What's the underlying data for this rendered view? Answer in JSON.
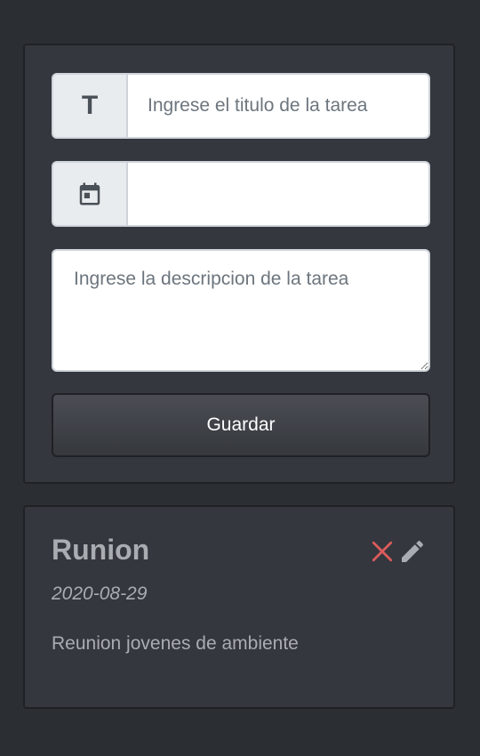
{
  "form": {
    "title_icon": "T",
    "title_placeholder": "Ingrese el titulo de la tarea",
    "title_value": "",
    "date_icon": "calendar-icon",
    "date_value": "",
    "description_placeholder": "Ingrese la descripcion de la tarea",
    "description_value": "",
    "save_label": "Guardar"
  },
  "tasks": [
    {
      "title": "Runion",
      "date": "2020-08-29",
      "description": "Reunion jovenes de ambiente",
      "delete_icon": "close-icon",
      "edit_icon": "pencil-icon"
    }
  ],
  "colors": {
    "background": "#2b2e33",
    "card": "#34373d",
    "delete": "#dc5b5b",
    "muted_text": "#a9acb1"
  }
}
